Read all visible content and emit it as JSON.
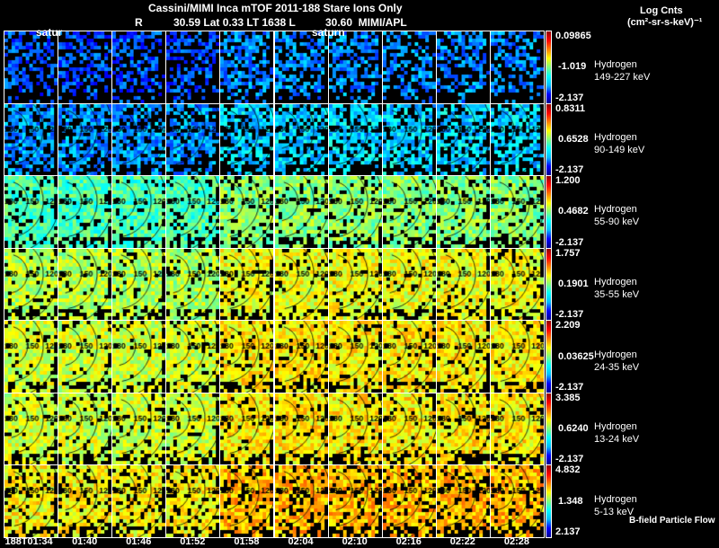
{
  "header": {
    "line1": "Cassini/MIMI Inca mTOF  2011-188   Stare   Ions Only",
    "line2_r": "R",
    "line2_rest": "30.59 Lat 0.33 LT 1638 L          30.60  MIMI/APL",
    "overlay_left": "satur",
    "overlay_mid": "saturn",
    "units_title": "Log Cnts",
    "units": "(cm²-sr-s-keV)⁻¹"
  },
  "footer_note": "B-field Particle Flow",
  "time_labels": [
    "188T01:34",
    "01:40",
    "01:46",
    "01:52",
    "01:58",
    "02:04",
    "02:10",
    "02:16",
    "02:22",
    "02:28"
  ],
  "contour_labels": [
    "180",
    "150",
    "120"
  ],
  "chart_data": {
    "type": "heatmap",
    "title": "Cassini/MIMI Inca mTOF 2011-188 Stare Ions Only",
    "colorbar_label": "Log Cnts (cm2-sr-s-keV)-1",
    "x": [
      "188T01:34",
      "01:40",
      "01:46",
      "01:52",
      "01:58",
      "02:04",
      "02:10",
      "02:16",
      "02:22",
      "02:28"
    ],
    "rows": [
      {
        "species": "Hydrogen",
        "energy": "149-227 keV",
        "max": "0.09865",
        "mid": "-1.019",
        "min": "-2.137",
        "level": 0.2,
        "missing": 0.45
      },
      {
        "species": "Hydrogen",
        "energy": "90-149 keV",
        "max": "0.8311",
        "mid": "0.6528",
        "min": "-2.137",
        "level": 0.27,
        "missing": 0.3
      },
      {
        "species": "Hydrogen",
        "energy": "55-90 keV",
        "max": "1.200",
        "mid": "0.4682",
        "min": "-2.137",
        "level": 0.45,
        "missing": 0.12
      },
      {
        "species": "Hydrogen",
        "energy": "35-55 keV",
        "max": "1.757",
        "mid": "0.1901",
        "min": "-2.137",
        "level": 0.55,
        "missing": 0.1
      },
      {
        "species": "Hydrogen",
        "energy": "24-35 keV",
        "max": "2.209",
        "mid": "0.03625",
        "min": "-2.137",
        "level": 0.58,
        "missing": 0.1
      },
      {
        "species": "Hydrogen",
        "energy": "13-24 keV",
        "max": "3.385",
        "mid": "0.6240",
        "min": "-2.137",
        "level": 0.58,
        "missing": 0.12
      },
      {
        "species": "Hydrogen",
        "energy": "5-13 keV",
        "max": "4.832",
        "mid": "1.348",
        "min": "2.137",
        "level": 0.63,
        "missing": 0.2
      }
    ]
  }
}
